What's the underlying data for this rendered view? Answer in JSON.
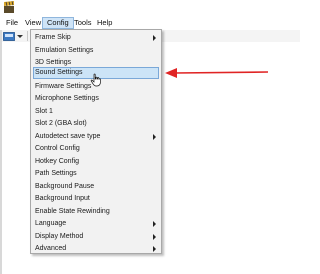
{
  "app": {
    "icon_name": "clapperboard-icon"
  },
  "menubar": {
    "items": [
      {
        "label": "File"
      },
      {
        "label": "View"
      },
      {
        "label": "Config"
      },
      {
        "label": "Tools"
      },
      {
        "label": "Help"
      }
    ],
    "active_index": 2
  },
  "toolbar": {
    "icons": [
      "open-rom-icon",
      "dropdown-arrow-icon",
      "play-icon"
    ]
  },
  "config_menu": {
    "items": [
      {
        "label": "Frame Skip",
        "submenu": true
      },
      {
        "label": "Emulation Settings",
        "submenu": false
      },
      {
        "label": "3D Settings",
        "submenu": false
      },
      {
        "label": "Sound Settings",
        "submenu": false
      },
      {
        "label": "Firmware Settings",
        "submenu": false
      },
      {
        "label": "Microphone Settings",
        "submenu": false
      },
      {
        "label": "Slot 1",
        "submenu": false
      },
      {
        "label": "Slot 2 (GBA slot)",
        "submenu": false
      },
      {
        "label": "Autodetect save type",
        "submenu": true
      },
      {
        "label": "Control Config",
        "submenu": false
      },
      {
        "label": "Hotkey Config",
        "submenu": false
      },
      {
        "label": "Path Settings",
        "submenu": false
      },
      {
        "label": "Background Pause",
        "submenu": false
      },
      {
        "label": "Background Input",
        "submenu": false
      },
      {
        "label": "Enable State Rewinding",
        "submenu": false
      },
      {
        "label": "Language",
        "submenu": true
      },
      {
        "label": "Display Method",
        "submenu": true
      },
      {
        "label": "Advanced",
        "submenu": true
      }
    ],
    "highlighted_index": 3
  },
  "annotation": {
    "arrow_color": "#e02424",
    "points_to": "Sound Settings"
  },
  "colors": {
    "menu_background": "#f2f2f2",
    "highlight_background": "#cce4f7",
    "highlight_border": "#7aa8d8"
  }
}
